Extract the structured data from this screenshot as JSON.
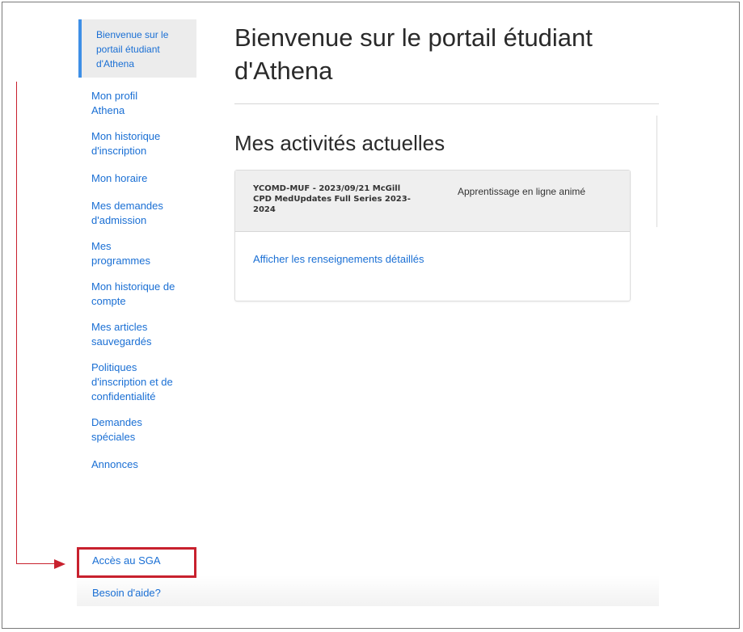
{
  "sidebar": {
    "active_item": "Bienvenue sur le portail étudiant d'Athena",
    "items": [
      "Mon profil Athena",
      "Mon historique d'inscription",
      "Mon horaire",
      "Mes demandes d'admission",
      "Mes programmes",
      "Mon historique de compte",
      "Mes articles sauvegardés",
      "Politiques d'inscription et de confidentialité",
      "Demandes spéciales",
      "Annonces"
    ],
    "highlighted_item": "Accès au SGA",
    "help_item": "Besoin d'aide?"
  },
  "main": {
    "title": "Bienvenue sur le portail étudiant d'Athena",
    "section_title": "Mes activités actuelles",
    "activity": {
      "name": "YCOMD-MUF - 2023/09/21 McGill CPD MedUpdates Full Series 2023-2024",
      "type": "Apprentissage en ligne animé",
      "details_link": "Afficher les renseignements détaillés"
    }
  },
  "colors": {
    "link": "#1a6fd4",
    "highlight": "#c8212e",
    "active_border": "#3e8fe6"
  }
}
